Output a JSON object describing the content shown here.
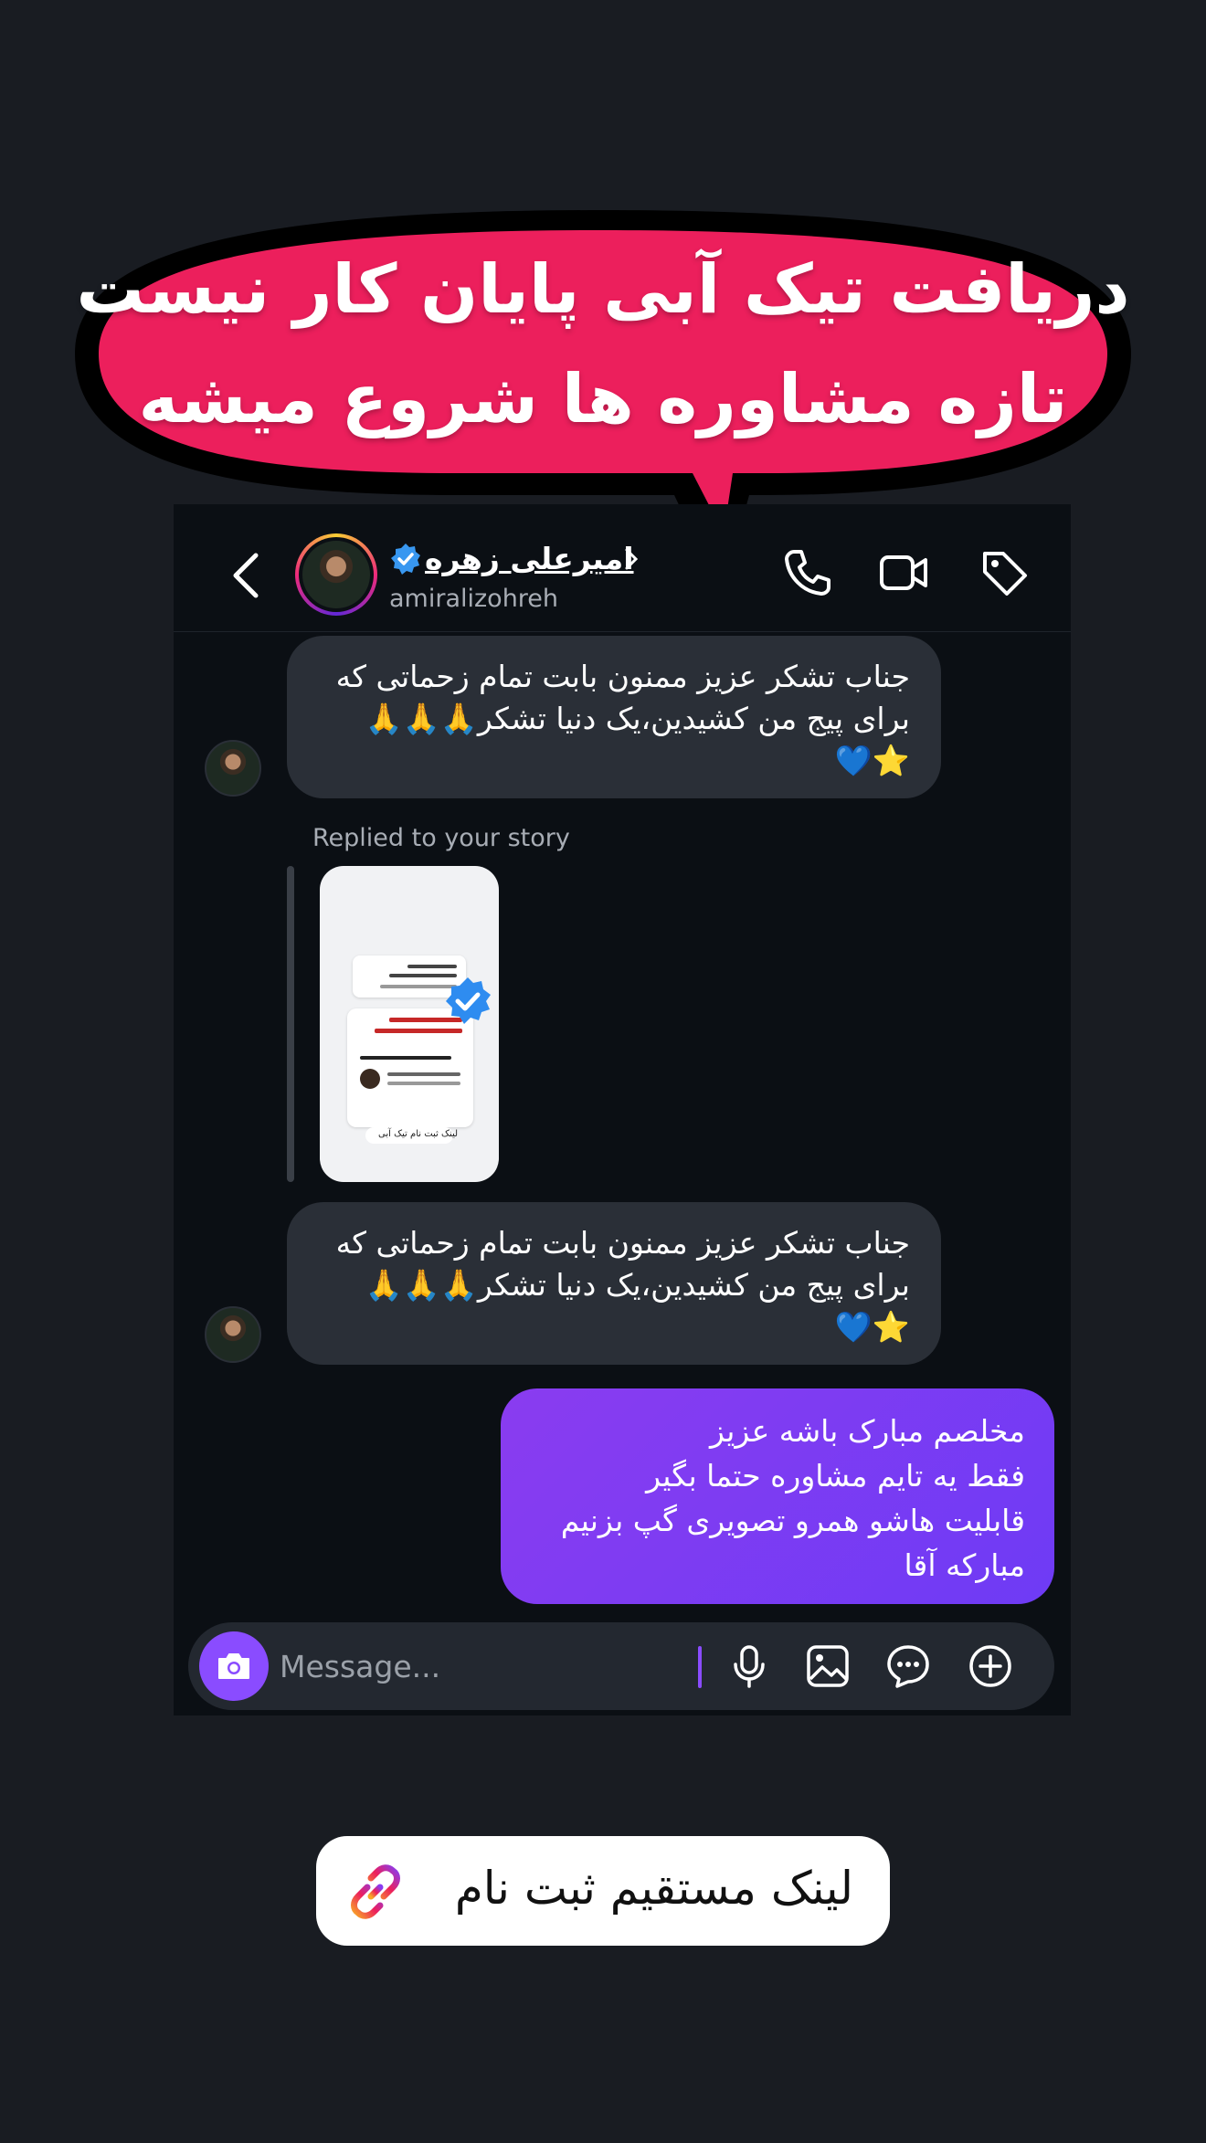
{
  "headline": {
    "line1": "دریافت تیک آبی پایان کار نیست",
    "line2": "تازه مشاوره ها شروع میشه",
    "fill_color": "#ec1f5c",
    "outline_color": "#000000"
  },
  "header": {
    "contact_name": "امیرعلی زهره",
    "handle": "amiralizohreh",
    "back_icon": "chevron-left-icon",
    "call_icon": "phone-icon",
    "video_icon": "video-icon",
    "tag_icon": "tag-icon"
  },
  "messages": [
    {
      "direction": "in",
      "text": "جناب تشکر عزیز ممنون بابت تمام زحماتی که\nبرای پیج من کشیدین،یک دنیا تشکر🙏🙏🙏\n⭐💙"
    },
    {
      "direction": "in",
      "reply_label": "Replied to your story",
      "story_link_text": "لینک ثبت نام تیک آبی"
    },
    {
      "direction": "in",
      "text": "جناب تشکر عزیز ممنون بابت تمام زحماتی که\nبرای پیج من کشیدین،یک دنیا تشکر🙏🙏🙏\n⭐💙"
    },
    {
      "direction": "out",
      "text": "مخلصم مبارک باشه عزیز\nفقط یه تایم مشاوره حتما بگیر\nقابلیت هاشو همرو  تصویری گپ بزنیم\nمبارکه آقا"
    }
  ],
  "composer": {
    "placeholder": "Message...",
    "accent": "#8a4cff",
    "icons": [
      "camera-icon",
      "mic-icon",
      "gallery-icon",
      "sticker-icon",
      "plus-icon"
    ]
  },
  "cta": {
    "label": "لینک مستقیم ثبت نام",
    "icon": "link-icon"
  }
}
